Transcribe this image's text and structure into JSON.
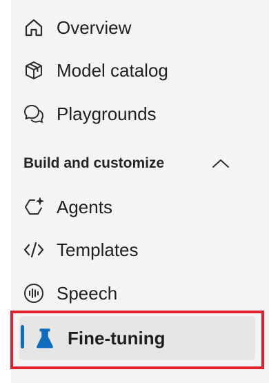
{
  "nav": {
    "items": [
      {
        "label": "Overview",
        "icon": "home-icon"
      },
      {
        "label": "Model catalog",
        "icon": "cube-icon"
      },
      {
        "label": "Playgrounds",
        "icon": "chat-icon"
      }
    ],
    "section": {
      "title": "Build and customize",
      "state": "expanded",
      "items": [
        {
          "label": "Agents",
          "icon": "agent-sparkle-icon"
        },
        {
          "label": "Templates",
          "icon": "code-icon"
        },
        {
          "label": "Speech",
          "icon": "speech-icon"
        },
        {
          "label": "Fine-tuning",
          "icon": "flask-icon",
          "selected": true
        }
      ]
    }
  },
  "colors": {
    "accent": "#0f6cbd",
    "highlight_border": "#e0202c",
    "nav_background": "#f4f4f4",
    "selected_background": "#e6e6e6"
  }
}
